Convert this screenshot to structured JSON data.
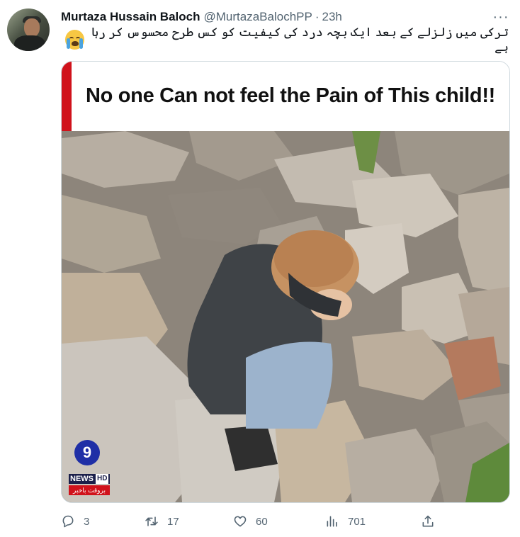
{
  "author": {
    "name": "Murtaza Hussain Baloch",
    "handle": "@MurtazaBalochPP",
    "separator": "·",
    "time": "23h"
  },
  "more_label": "···",
  "tweet_text": "ترکی میں زلزلے کے بعد ایک بچہ درد کی کیفیت کو کس طرح محسوس کر رہا ہے",
  "tweet_emoji": "loudly-crying-face-emoji",
  "media": {
    "headline": "No one Can not feel the Pain of This  child!!",
    "logo": {
      "mark": "9",
      "brand": "NEWS",
      "hd": "HD",
      "tagline": "بروقت باخبر"
    }
  },
  "actions": {
    "reply_count": "3",
    "retweet_count": "17",
    "like_count": "60",
    "view_count": "701"
  },
  "colors": {
    "text": "#0f1419",
    "muted": "#536471",
    "banner_red": "#d0121b",
    "logo_blue": "#1f2fa6"
  }
}
